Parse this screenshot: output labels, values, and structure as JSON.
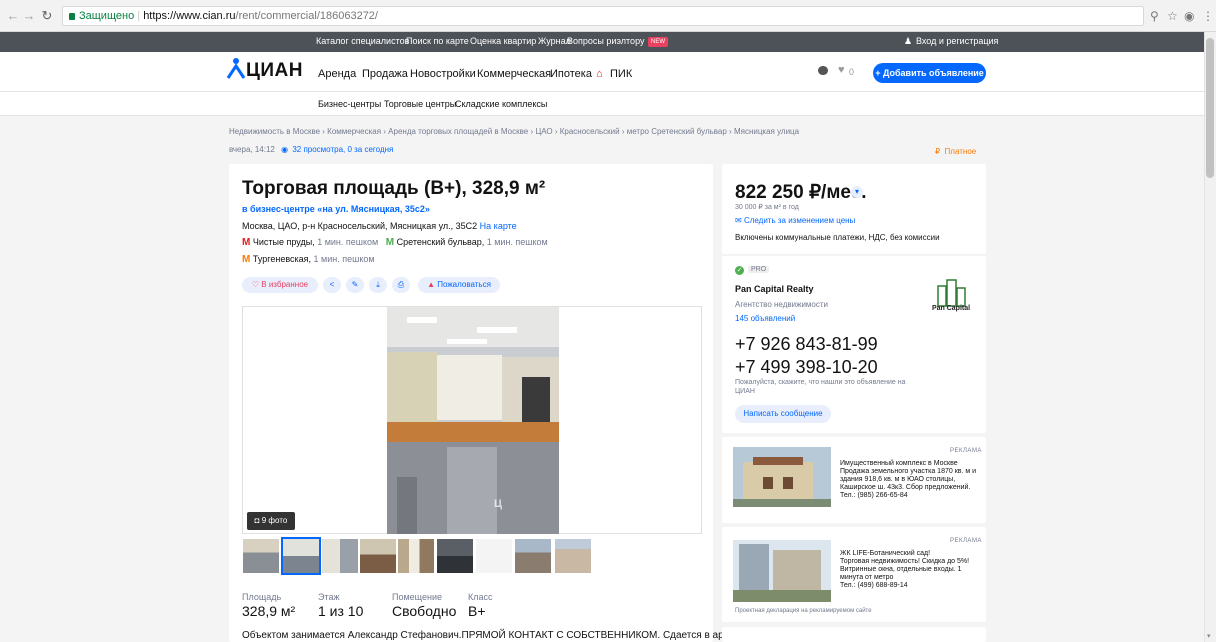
{
  "browser": {
    "secure_label": "Защищено",
    "url_host": "https://www.cian.ru",
    "url_path": "/rent/commercial/186063272/"
  },
  "topnav": {
    "items": [
      "Каталог специалистов",
      "Поиск по карте",
      "Оценка квартир",
      "Журнал",
      "Вопросы риэлтору"
    ],
    "new_badge": "NEW",
    "login": "Вход и регистрация"
  },
  "header": {
    "logo": "ЦИАН",
    "menu": [
      "Аренда",
      "Продажа",
      "Новостройки",
      "Коммерческая",
      "Ипотека",
      "ПИК"
    ],
    "favorites_count": "0",
    "add_button": "+ Добавить объявление"
  },
  "subnav": {
    "items": [
      "Бизнес-центры",
      "Торговые центры",
      "Складские комплексы"
    ]
  },
  "breadcrumbs": "Недвижимость в Москве  ›  Коммерческая  ›  Аренда торговых площадей в Москве  ›  ЦАО  ›  Красносельский  ›  метро Сретенский бульвар  ›  Мясницкая улица",
  "meta": {
    "date": "вчера, 14:12",
    "views": "32 просмотра, 0 за сегодня",
    "paid": "Платное"
  },
  "listing": {
    "title": "Торговая площадь (B+), 328,9 м²",
    "business_center": "в бизнес-центре «на ул. Мясницкая, 35с2»",
    "address": "Москва, ЦАО, р-н Красносельский, Мясницкая ул., 35С2",
    "map_link": "На карте",
    "metro": [
      {
        "name": "Чистые пруды",
        "walk": "1 мин. пешком"
      },
      {
        "name": "Сретенский бульвар",
        "walk": "1 мин. пешком"
      },
      {
        "name": "Тургеневская",
        "walk": "1 мин. пешком"
      }
    ],
    "actions": {
      "favorite": "В избранное",
      "complain": "Пожаловаться"
    },
    "photo_count": "9 фото",
    "specs": [
      {
        "label": "Площадь",
        "value": "328,9 м²"
      },
      {
        "label": "Этаж",
        "value": "1 из 10"
      },
      {
        "label": "Помещение",
        "value": "Свободно"
      },
      {
        "label": "Класс",
        "value": "B+"
      }
    ],
    "description": "Объектом занимается Александр Стефанович.ПРЯМОЙ КОНТАКТ С СОБСТВЕННИКОМ. Сдается в аренду"
  },
  "price": {
    "value": "822 250 ₽/мес.",
    "per_meter": "30 000 ₽ за м² в год",
    "watch": "Следить за изменением цены",
    "included": "Включены коммунальные платежи, НДС, без комиссии"
  },
  "agent": {
    "pro_label": "PRO",
    "name": "Pan Capital Realty",
    "type": "Агентство недвижимости",
    "count": "145 объявлений",
    "logo_text": "Pan Capital",
    "phones": [
      "+7 926 843-81-99",
      "+7 499 398-10-20"
    ],
    "note": "Пожалуйста, скажите, что нашли это объявление на ЦИАН",
    "message_button": "Написать сообщение"
  },
  "ads": [
    {
      "label": "РЕКЛАМА",
      "title": "Имущественный комплекс в Москве",
      "text": "Продажа земельного участка 1870 кв. м и здания 918,6 кв. м в ЮАО столицы, Каширское ш. 43к3. Сбор предложений.",
      "phone": "Тел.: (985) 266-65-84"
    },
    {
      "label": "РЕКЛАМА",
      "title": "ЖК LIFE-Ботанический сад!",
      "text": "Торговая недвижимость! Скидка до 5%! Витринные окна, отдельные входы. 1 минута от метро",
      "phone": "Тел.: (499) 688-89-14",
      "footnote": "Проектная декларация на рекламируемом сайте"
    }
  ],
  "colors": {
    "accent": "#0468ff",
    "topnav_bg": "#4d5259",
    "paid": "#ff7a00"
  }
}
